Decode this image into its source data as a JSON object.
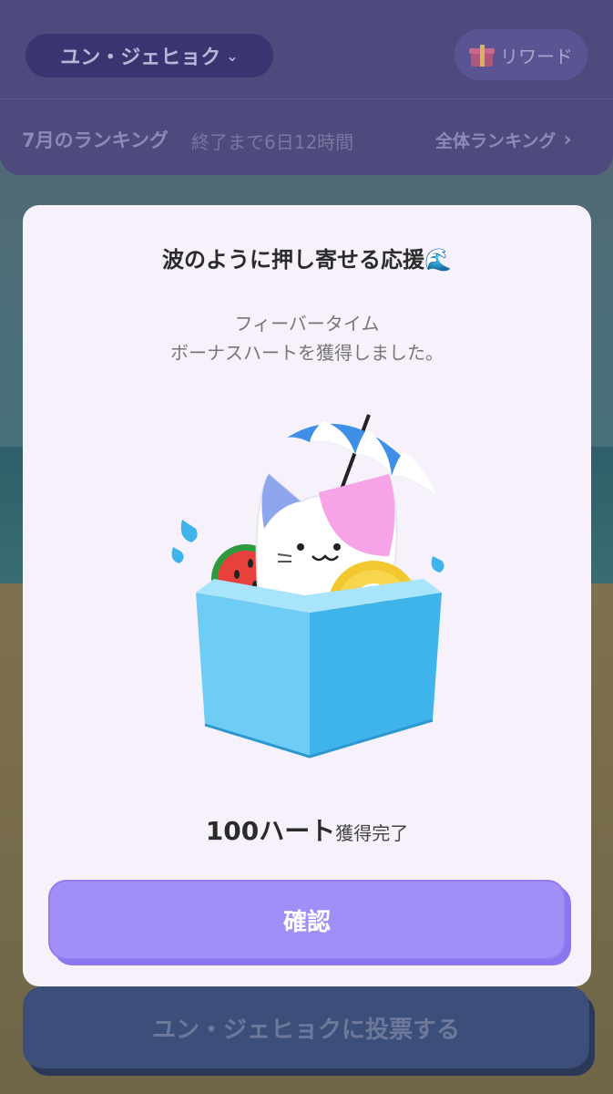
{
  "header": {
    "account_name": "ユン・ジェヒョク",
    "reward_label": "リワード",
    "ranking_title": "7月のランキング",
    "ranking_remaining": "終了まで6日12時間",
    "all_ranking_label": "全体ランキング"
  },
  "background": {
    "vote_button_label": "ユン・ジェヒョクに投票する"
  },
  "modal": {
    "title": "波のように押し寄せる応援🌊",
    "message_line1": "フィーバータイム",
    "message_line2": "ボーナスハートを獲得しました。",
    "reward_amount": "100ハート",
    "reward_suffix": "獲得完了",
    "confirm_label": "確認"
  },
  "colors": {
    "accent": "#a18ff7",
    "header": "#4f4a7e",
    "modal_bg": "#f6f1fb"
  }
}
